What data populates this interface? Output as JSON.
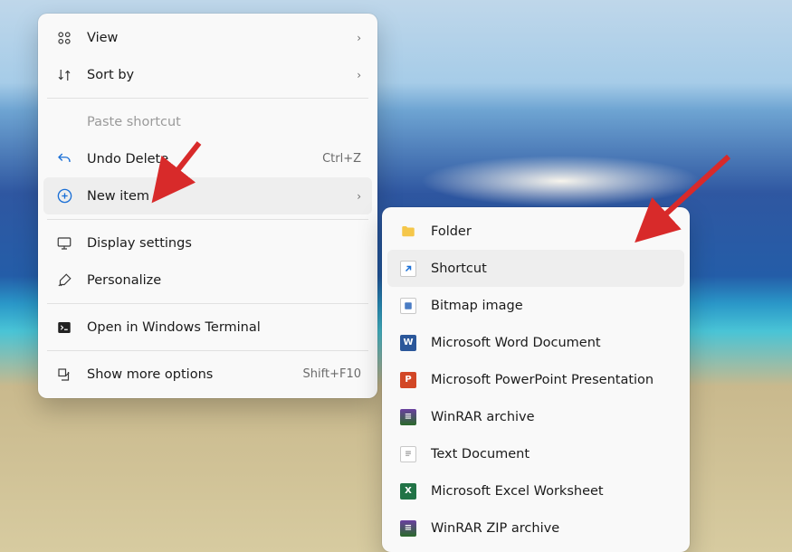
{
  "primaryMenu": {
    "items": [
      {
        "label": "View",
        "chevron": "›"
      },
      {
        "label": "Sort by",
        "chevron": "›"
      }
    ],
    "paste": {
      "label": "Paste shortcut"
    },
    "undo": {
      "label": "Undo Delete",
      "accel": "Ctrl+Z"
    },
    "newItem": {
      "label": "New item",
      "chevron": "›"
    },
    "display": {
      "label": "Display settings"
    },
    "personalize": {
      "label": "Personalize"
    },
    "terminal": {
      "label": "Open in Windows Terminal"
    },
    "more": {
      "label": "Show more options",
      "accel": "Shift+F10"
    }
  },
  "subMenu": {
    "folder": {
      "label": "Folder"
    },
    "shortcut": {
      "label": "Shortcut"
    },
    "bitmap": {
      "label": "Bitmap image"
    },
    "word": {
      "label": "Microsoft Word Document"
    },
    "ppt": {
      "label": "Microsoft PowerPoint Presentation"
    },
    "rar": {
      "label": "WinRAR archive"
    },
    "txt": {
      "label": "Text Document"
    },
    "xls": {
      "label": "Microsoft Excel Worksheet"
    },
    "zip": {
      "label": "WinRAR ZIP archive"
    }
  }
}
